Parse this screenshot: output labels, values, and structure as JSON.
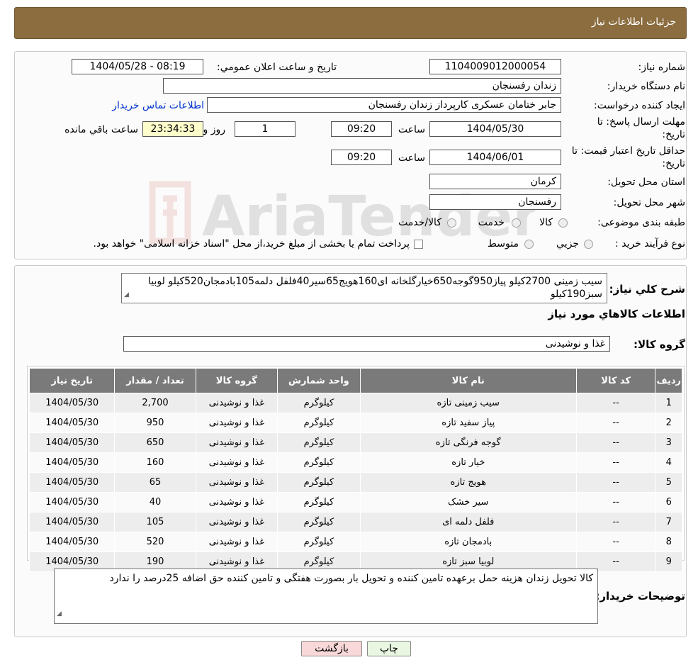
{
  "header": {
    "title": "جزئیات اطلاعات نیاز"
  },
  "form": {
    "need_number_label": "شماره نیاز:",
    "need_number": "1104009012000054",
    "announce_label": "تاریخ و ساعت اعلان عمومي:",
    "announce_value": "1404/05/28 - 08:19",
    "buyer_org_label": "نام دستگاه خریدار:",
    "buyer_org": "زندان رفسنجان",
    "creator_label": "ایجاد کننده درخواست:",
    "creator": "جابر ختامان عسکری کارپرداز زندان رفسنجان",
    "contact_link": "اطلاعات تماس خریدار",
    "deadline_label_1": "مهلت ارسال پاسخ: تا",
    "deadline_label_2": "تاریخ:",
    "deadline_date": "1404/05/30",
    "time_label": "ساعت",
    "deadline_time": "09:20",
    "days_value": "1",
    "days_label": "روز و",
    "remaining_time": "23:34:33",
    "remaining_label": "ساعت باقي مانده",
    "validity_label_1": "حداقل تاریخ اعتبار قیمت: تا",
    "validity_label_2": "تاریخ:",
    "validity_date": "1404/06/01",
    "validity_time": "09:20",
    "province_label": "استان محل تحویل:",
    "province": "کرمان",
    "city_label": "شهر محل تحویل:",
    "city": "رفسنجان",
    "category_label": "طبقه بندی موضوعی:",
    "category_options": [
      "کالا",
      "خدمت",
      "کالا/خدمت"
    ],
    "process_label": "نوع فرآیند خرید :",
    "process_options": [
      "جزیي",
      "متوسط"
    ],
    "process_note": "پرداخت تمام یا بخشی از مبلغ خرید،از محل \"اسناد خزانه اسلامی\" خواهد بود."
  },
  "summary": {
    "desc_label": "شرح کلي نیاز:",
    "desc_text": "سیب زمینی 2700کیلو پیاز950گوجه650خیارگلخانه ای160هویج65سیر40فلفل دلمه105بادمجان520کیلو لوبیا سبز190کیلو",
    "goods_info_title": "اطلاعات کالاهاي مورد نیاز",
    "group_label": "گروه کالا:",
    "group_value": "غذا و نوشیدنی"
  },
  "table": {
    "headers": [
      "ردیف",
      "کد کالا",
      "نام کالا",
      "واحد شمارش",
      "گروه کالا",
      "تعداد / مقدار",
      "تاریخ نیاز"
    ],
    "rows": [
      [
        "1",
        "--",
        "سیب زمینی تازه",
        "کیلوگرم",
        "غذا و نوشیدنی",
        "2,700",
        "1404/05/30"
      ],
      [
        "2",
        "--",
        "پیاز سفید تازه",
        "کیلوگرم",
        "غذا و نوشیدنی",
        "950",
        "1404/05/30"
      ],
      [
        "3",
        "--",
        "گوجه فرنگی تازه",
        "کیلوگرم",
        "غذا و نوشیدنی",
        "650",
        "1404/05/30"
      ],
      [
        "4",
        "--",
        "خیار تازه",
        "کیلوگرم",
        "غذا و نوشیدنی",
        "160",
        "1404/05/30"
      ],
      [
        "5",
        "--",
        "هویج تازه",
        "کیلوگرم",
        "غذا و نوشیدنی",
        "65",
        "1404/05/30"
      ],
      [
        "6",
        "--",
        "سیر خشک",
        "کیلوگرم",
        "غذا و نوشیدنی",
        "40",
        "1404/05/30"
      ],
      [
        "7",
        "--",
        "فلفل دلمه ای",
        "کیلوگرم",
        "غذا و نوشیدنی",
        "105",
        "1404/05/30"
      ],
      [
        "8",
        "--",
        "بادمجان تازه",
        "کیلوگرم",
        "غذا و نوشیدنی",
        "520",
        "1404/05/30"
      ],
      [
        "9",
        "--",
        "لوبیا سبز تازه",
        "کیلوگرم",
        "غذا و نوشیدنی",
        "190",
        "1404/05/30"
      ]
    ]
  },
  "buyer_notes": {
    "label": "توضیحات خریدار:",
    "text": "کالا تحویل زندان هزینه حمل برعهده تامین کننده و تحویل بار بصورت هفتگی و تامین کننده حق اضافه 25درصد را ندارد"
  },
  "buttons": {
    "print": "چاپ",
    "back": "بازگشت"
  },
  "colors": {
    "header_bg": "#8b6d3f",
    "table_header_bg": "#7a7a7a",
    "back_button_bg": "#f8d8d8",
    "print_button_bg": "#e9f6e2",
    "remaining_bg": "#ffffcc"
  },
  "watermark": "AriaTender.neT"
}
